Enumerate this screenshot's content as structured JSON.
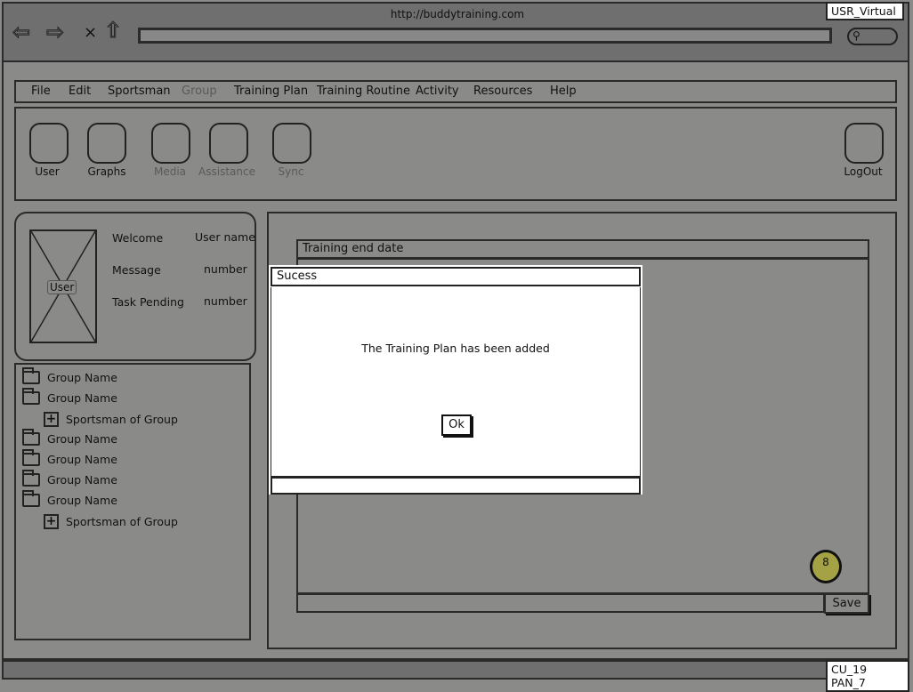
{
  "browser": {
    "url": "http://buddytraining.com",
    "user_tag": "USR_Virtual",
    "screen_tag": "CU_19 PAN_7"
  },
  "menu": [
    "File",
    "Edit",
    "Sportsman",
    "Group",
    "Training Plan",
    "Training Routine",
    "Activity",
    "Resources",
    "Help"
  ],
  "toolbar": {
    "user": "User",
    "graphs": "Graphs",
    "media": "Media",
    "assistance": "Assistance",
    "sync": "Sync",
    "logout": "LogOut"
  },
  "profile": {
    "avatar_label": "User",
    "welcome": "Welcome",
    "user_name": "User name",
    "message": "Message",
    "message_value": "number",
    "task_pending": "Task Pending",
    "task_value": "number"
  },
  "tree": [
    {
      "type": "folder",
      "label": "Group Name"
    },
    {
      "type": "folder-open",
      "label": "Group Name"
    },
    {
      "type": "child",
      "label": "Sportsman of Group"
    },
    {
      "type": "folder",
      "label": "Group Name"
    },
    {
      "type": "folder",
      "label": "Group Name"
    },
    {
      "type": "folder",
      "label": "Group Name"
    },
    {
      "type": "folder-open",
      "label": "Group Name"
    },
    {
      "type": "child",
      "label": "Sportsman of Group"
    }
  ],
  "form": {
    "end_date_label": "Training end date",
    "save": "Save",
    "badge": "8"
  },
  "dialog": {
    "title": "Sucess",
    "message": "The Training Plan has been added",
    "ok": "Ok"
  },
  "colors": {
    "background": "#8a8a89",
    "badge": "#a5a245"
  }
}
